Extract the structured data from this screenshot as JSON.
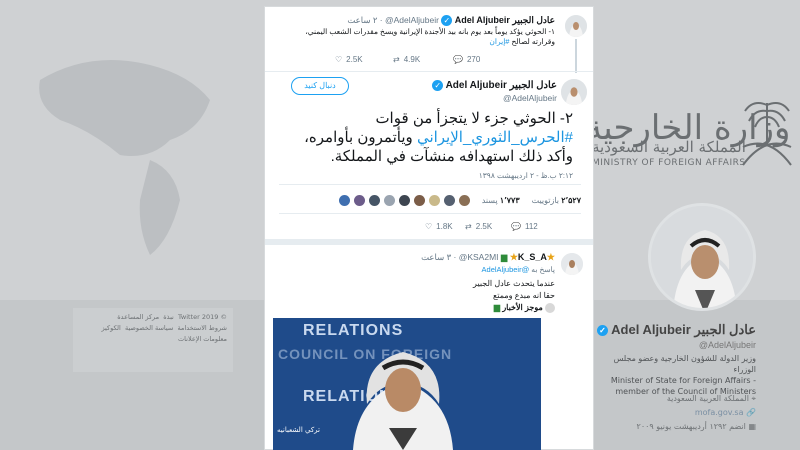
{
  "background": {
    "ministry_ar": "وزارة الخارجية",
    "ministry_ar_sub": "المملكة العربية السعودية",
    "ministry_en": "MINISTRY OF FOREIGN AFFAIRS",
    "footer_links": [
      "© 2019 Twitter",
      "نبذة",
      "مركز المساعدة",
      "شروط الاستخدامة",
      "سياسة الخصوصية",
      "الكوكيز",
      "معلومات الإعلانات"
    ],
    "profile": {
      "name": "Adel Aljubeir عادل الجبير",
      "handle": "@AdelAljubeir",
      "bio_ar": "وزير الدولة للشؤون الخارجية وعضو مجلس الوزراء",
      "bio_en": "Minister of State for Foreign Affairs - member of the Council of Ministers",
      "location": "المملكة العربية السعودية",
      "website": "mofa.gov.sa",
      "joined": "انضم ١٢٩٢ أرديبهشت يونيو ٢٠٠٩"
    }
  },
  "tweet_prev": {
    "name": "Adel Aljubeir عادل الجبير",
    "handle": "@AdelAljubeir",
    "time": "٢ ساعت",
    "text": "١- الحوثي يؤكد يوماً بعد يوم بانه بيد الأجندة الإيرانية ويسخ مقدرات الشعب اليمني، وقرارته لصالح",
    "hashtag": "#إيران",
    "replies": "270",
    "retweets": "4.9K",
    "likes": "2.5K"
  },
  "tweet_main": {
    "name": "Adel Aljubeir عادل الجبير",
    "handle": "@AdelAljubeir",
    "follow_label": "دنبال کنید",
    "line1": "٢- الحوثي جزء لا يتجزأ من قوات",
    "hashtag": "#الحرس_الثوري_الإيراني",
    "line2": " ويأتمرون بأوامره،",
    "line3": "وأكد ذلك استهدافه منشآت في المملكة.",
    "timestamp": "٢:١٢ ب.ظ - ٢ اردیبهشت ۱۳۹۸",
    "retweets_label": "بازتوییت",
    "retweets_count": "۲٬۵۲۷",
    "likes_label": "پسند",
    "likes_count": "۱٬۷۷۳",
    "replies": "112",
    "retweets": "2.5K",
    "likes": "1.8K"
  },
  "tweet_reply": {
    "name": "K_S_A",
    "handle": "@KSA2MI",
    "time": "٣ ساعت",
    "reply_to_label": "پاسخ به",
    "reply_to": "@AdelAljubeir",
    "line1": "عندما يتحدث عادل الجبير",
    "line2": "حقا انه مبدع وممتع",
    "quoted": "موجز الأخبار",
    "video_caption": "تركي الشعبانيه"
  },
  "colors": {
    "accent": "#1da1f2",
    "link": "#1b95e0",
    "text": "#14171a",
    "muted": "#657786"
  }
}
